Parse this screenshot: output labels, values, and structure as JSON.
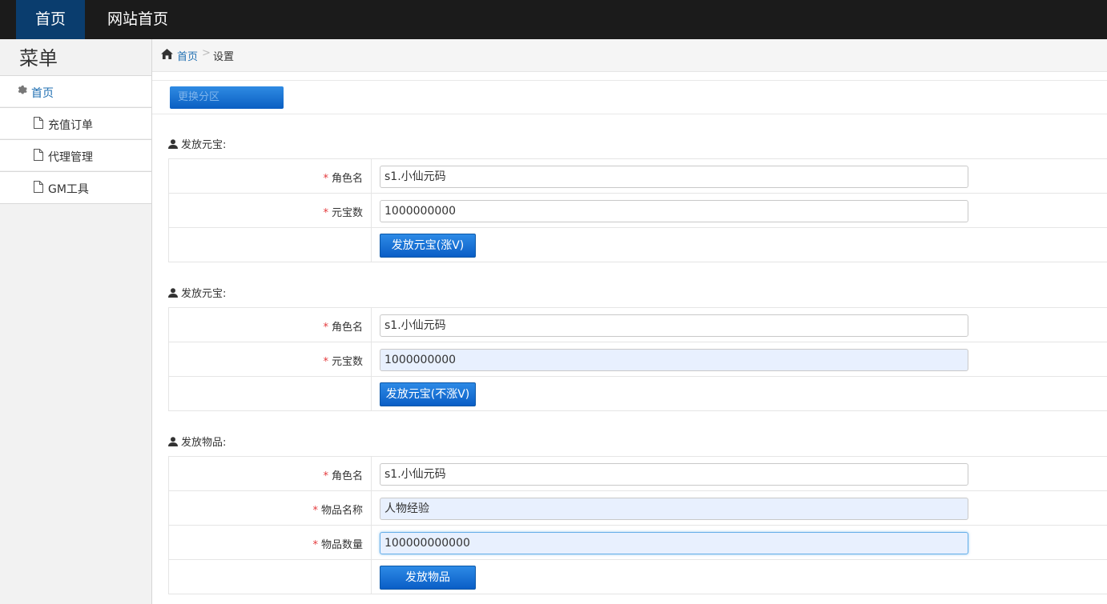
{
  "topnav": {
    "home": "首页",
    "site_home": "网站首页"
  },
  "sidebar": {
    "title": "菜单",
    "items": [
      {
        "label": "首页",
        "icon": "gear-icon"
      },
      {
        "label": "充值订单",
        "icon": "document-icon"
      },
      {
        "label": "代理管理",
        "icon": "document-icon"
      },
      {
        "label": "GM工具",
        "icon": "document-icon"
      }
    ]
  },
  "breadcrumb": {
    "home": "首页",
    "separator": ">",
    "current": "设置"
  },
  "toolbar": {
    "switch_zone": "更换分区"
  },
  "sections": [
    {
      "title": "发放元宝:",
      "fields": [
        {
          "label": "角色名",
          "value": "s1.小仙元码"
        },
        {
          "label": "元宝数",
          "value": "1000000000"
        }
      ],
      "button": "发放元宝(涨V)"
    },
    {
      "title": "发放元宝:",
      "fields": [
        {
          "label": "角色名",
          "value": "s1.小仙元码"
        },
        {
          "label": "元宝数",
          "value": "1000000000"
        }
      ],
      "button": "发放元宝(不涨V)"
    },
    {
      "title": "发放物品:",
      "fields": [
        {
          "label": "角色名",
          "value": "s1.小仙元码"
        },
        {
          "label": "物品名称",
          "value": "人物经验"
        },
        {
          "label": "物品数量",
          "value": "100000000000"
        }
      ],
      "button": "发放物品"
    }
  ],
  "required_mark": "*",
  "colors": {
    "topbar": "#1b1b1b",
    "active_tab": "#0a3d6e",
    "primary_button": "#0a5ec6",
    "link": "#1f6fb2",
    "required": "#e4393c"
  }
}
